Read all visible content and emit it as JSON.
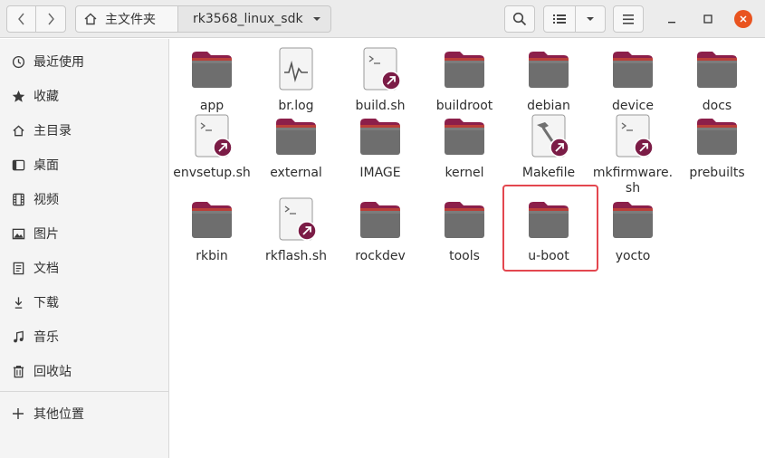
{
  "header": {
    "back_icon": "chevron-left-icon",
    "forward_icon": "chevron-right-icon",
    "home_label": "主文件夹",
    "current_folder": "rk3568_linux_sdk",
    "search_icon": "search-icon",
    "list_view_icon": "list-view-icon",
    "view_options_icon": "chevron-down-icon",
    "menu_icon": "hamburger-menu-icon",
    "accent": "#e95420"
  },
  "sidebar": {
    "items": [
      {
        "label": "最近使用",
        "icon": "clock-icon"
      },
      {
        "label": "收藏",
        "icon": "star-icon"
      },
      {
        "label": "主目录",
        "icon": "home-icon"
      },
      {
        "label": "桌面",
        "icon": "desktop-icon"
      },
      {
        "label": "视频",
        "icon": "film-icon"
      },
      {
        "label": "图片",
        "icon": "image-icon"
      },
      {
        "label": "文档",
        "icon": "document-icon"
      },
      {
        "label": "下载",
        "icon": "download-icon"
      },
      {
        "label": "音乐",
        "icon": "music-icon"
      },
      {
        "label": "回收站",
        "icon": "trash-icon"
      }
    ],
    "other_locations": {
      "label": "其他位置",
      "icon": "plus-icon"
    }
  },
  "files": [
    {
      "name": "app",
      "type": "folder"
    },
    {
      "name": "br.log",
      "type": "log"
    },
    {
      "name": "build.sh",
      "type": "script-link"
    },
    {
      "name": "buildroot",
      "type": "folder"
    },
    {
      "name": "debian",
      "type": "folder"
    },
    {
      "name": "device",
      "type": "folder"
    },
    {
      "name": "docs",
      "type": "folder"
    },
    {
      "name": "envsetup.sh",
      "type": "script-link"
    },
    {
      "name": "external",
      "type": "folder"
    },
    {
      "name": "IMAGE",
      "type": "folder"
    },
    {
      "name": "kernel",
      "type": "folder"
    },
    {
      "name": "Makefile",
      "type": "makefile-link"
    },
    {
      "name": "mkfirmware.sh",
      "type": "script-link"
    },
    {
      "name": "prebuilts",
      "type": "folder"
    },
    {
      "name": "rkbin",
      "type": "folder"
    },
    {
      "name": "rkflash.sh",
      "type": "script-link"
    },
    {
      "name": "rockdev",
      "type": "folder"
    },
    {
      "name": "tools",
      "type": "folder"
    },
    {
      "name": "u-boot",
      "type": "folder"
    },
    {
      "name": "yocto",
      "type": "folder"
    }
  ],
  "highlighted_item": "u-boot",
  "colors": {
    "folder_tab": "#8c1f4a",
    "folder_body": "#6e6e6e",
    "link_badge": "#7b1c46",
    "highlight": "#e3474f"
  }
}
